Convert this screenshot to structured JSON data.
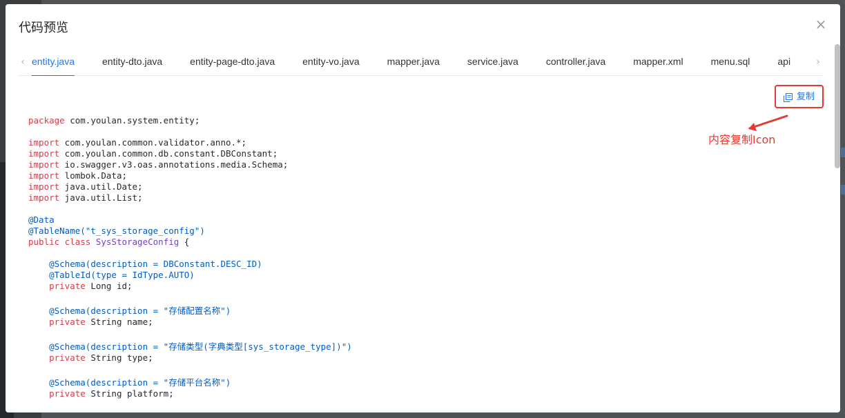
{
  "modal": {
    "title": "代码预览",
    "close": "×"
  },
  "tabs": {
    "prev": "‹",
    "next": "›",
    "items": [
      "entity.java",
      "entity-dto.java",
      "entity-page-dto.java",
      "entity-vo.java",
      "mapper.java",
      "service.java",
      "controller.java",
      "mapper.xml",
      "menu.sql",
      "api"
    ],
    "active_index": 0
  },
  "copy": {
    "label": "复制",
    "icon": "copy-icon"
  },
  "annotation": {
    "text": "内容复制Icon",
    "color": "#e53a2f"
  },
  "colors": {
    "accent": "#1677ff",
    "keyword": "#d73a49",
    "annotation": "#005cc5",
    "class": "#6f42c1"
  },
  "code": {
    "package_kw": "package",
    "package_rest": " com.youlan.system.entity;",
    "import_kw": "import",
    "imports": [
      " com.youlan.common.validator.anno.*;",
      " com.youlan.common.db.constant.DBConstant;",
      " io.swagger.v3.oas.annotations.media.Schema;",
      " lombok.Data;",
      " java.util.Date;",
      " java.util.List;"
    ],
    "anno_data": "@Data",
    "anno_table": "@TableName(\"t_sys_storage_config\")",
    "class_kw": "public class ",
    "class_name": "SysStorageConfig",
    "class_rest": " {",
    "indent": "    ",
    "private_kw": "private",
    "fields": [
      {
        "annotations": [
          "@Schema(description = DBConstant.DESC_ID)",
          "@TableId(type = IdType.AUTO)"
        ],
        "decl": " Long id;"
      },
      {
        "annotations": [
          "@Schema(description = \"存储配置名称\")"
        ],
        "decl": " String name;"
      },
      {
        "annotations": [
          "@Schema(description = \"存储类型(字典类型[sys_storage_type])\")"
        ],
        "decl": " String type;"
      },
      {
        "annotations": [
          "@Schema(description = \"存储平台名称\")"
        ],
        "decl": " String platform;"
      }
    ]
  }
}
